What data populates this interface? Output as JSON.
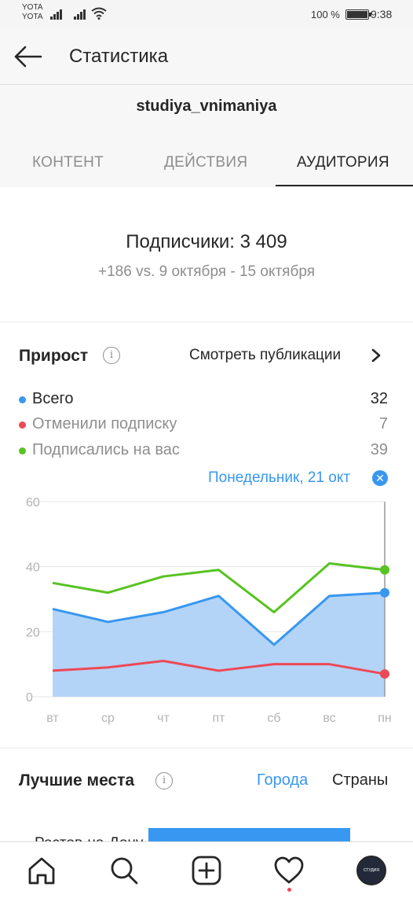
{
  "status_bar": {
    "carrier_1": "YOTA",
    "carrier_2": "YOTA",
    "battery_text": "100 %",
    "time": "9:38"
  },
  "header": {
    "title": "Статистика",
    "back_icon": "arrow-left-icon"
  },
  "profile": {
    "username": "studiya_vnimaniya"
  },
  "tabs": [
    {
      "label": "КОНТЕНТ",
      "active": false
    },
    {
      "label": "ДЕЙСТВИЯ",
      "active": false
    },
    {
      "label": "АУДИТОРИЯ",
      "active": true
    }
  ],
  "followers": {
    "title": "Подписчики: 3 409",
    "subtitle": "+186 vs. 9 октября - 15 октября"
  },
  "growth": {
    "title": "Прирост",
    "info_icon": "i",
    "view_posts": "Смотреть публикации",
    "legend": [
      {
        "label": "Всего",
        "value": "32",
        "color": "#3897f0"
      },
      {
        "label": "Отменили подписку",
        "value": "7",
        "color": "#ed4956"
      },
      {
        "label": "Подписались на вас",
        "value": "39",
        "color": "#58c322"
      }
    ],
    "selected_date": "Понедельник, 21 окт",
    "close_icon": "✕"
  },
  "chart_data": {
    "type": "line",
    "categories": [
      "вт",
      "ср",
      "чт",
      "пт",
      "сб",
      "вс",
      "пн"
    ],
    "y_ticks": [
      "0",
      "20",
      "40",
      "60"
    ],
    "ylim": [
      0,
      60
    ],
    "grid": true,
    "series": [
      {
        "name": "Всего",
        "values": [
          27,
          23,
          26,
          31,
          16,
          31,
          32
        ],
        "color": "#3897f0",
        "fill": "#b3d4f7"
      },
      {
        "name": "Отменили подписку",
        "values": [
          8,
          9,
          11,
          8,
          10,
          10,
          7
        ],
        "color": "#ed4956"
      },
      {
        "name": "Подписались на вас",
        "values": [
          35,
          32,
          37,
          39,
          26,
          41,
          39
        ],
        "color": "#58c322"
      }
    ],
    "selected_index": 6
  },
  "places": {
    "title": "Лучшие места",
    "tab_cities": "Города",
    "tab_countries": "Страны",
    "first_city": "Ростов-на-Дону",
    "accent": "#3897f0"
  },
  "bottom_nav": {
    "items": [
      "home-icon",
      "search-icon",
      "add-post-icon",
      "heart-icon",
      "profile-avatar"
    ],
    "avatar_text": "СТУДИЯ ВНИМАНИЯ"
  }
}
